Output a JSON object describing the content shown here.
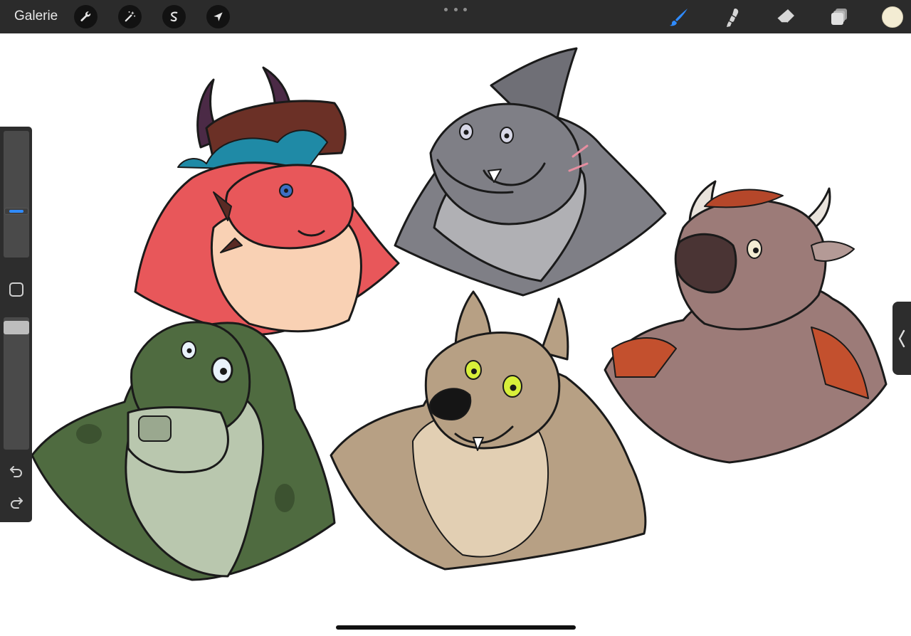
{
  "toolbar": {
    "gallery_label": "Galerie",
    "left_tools": [
      "wrench-icon",
      "magic-wand-icon",
      "selection-icon",
      "transform-arrow-icon"
    ],
    "right_tools": [
      "brush-icon",
      "smudge-icon",
      "eraser-icon",
      "layers-icon"
    ],
    "active_tool": "brush-icon",
    "accent_color": "#2f8bff",
    "current_color": "#f3ecd3"
  },
  "sidebar": {
    "brush_size_level": 0.64,
    "opacity_level": 0.0,
    "icons": [
      "modify-square-icon",
      "undo-icon",
      "redo-icon"
    ]
  },
  "canvas": {
    "characters": [
      "red-dragon",
      "grey-shark",
      "brown-bull",
      "green-crocodile",
      "brown-wolf"
    ],
    "palette": {
      "dragon": "#e8575a",
      "dragon_belly": "#f9d1b4",
      "horn": "#5a2a24",
      "shark": "#7f7f86",
      "shark_belly": "#b0b0b4",
      "bull": "#9c7b78",
      "bull_accent": "#c3502e",
      "croc": "#4f6b40",
      "croc_belly": "#b9c7ae",
      "wolf": "#b7a084",
      "wolf_light": "#e2cfb3",
      "line": "#1a1a1a"
    }
  }
}
